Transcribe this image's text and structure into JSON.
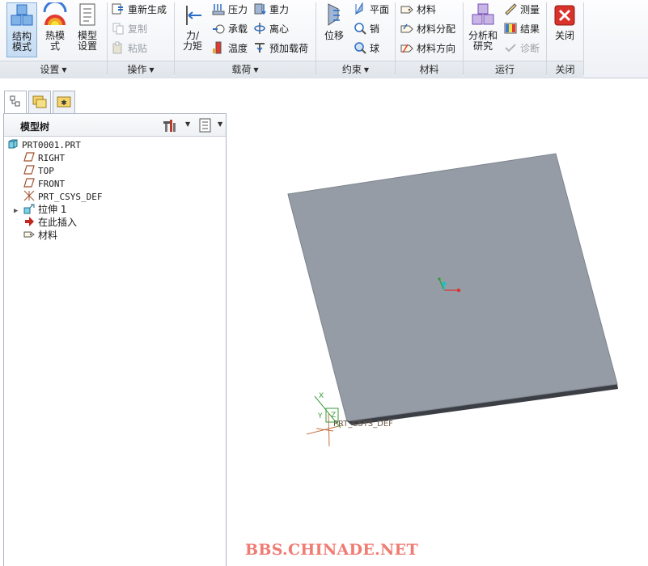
{
  "ribbon": {
    "groups": {
      "settings": "设置",
      "operations": "操作",
      "loads": "载荷",
      "constraints": "约束",
      "materials": "材料",
      "run": "运行",
      "close": "关闭"
    },
    "structure_mode": [
      "结构",
      "模式"
    ],
    "thermal_mode": [
      "热模",
      "式"
    ],
    "model_setup": [
      "模型",
      "设置"
    ],
    "regenerate": "重新生成",
    "copy": "复制",
    "paste": "粘贴",
    "force_moment": [
      "力/",
      "力矩"
    ],
    "pressure": "压力",
    "bearing": "承载",
    "temperature": "温度",
    "gravity": "重力",
    "centrifugal": "离心",
    "preload": "预加载荷",
    "displacement": "位移",
    "planar": "平面",
    "pin": "销",
    "ball": "球",
    "material": "材料",
    "material_assign": "材料分配",
    "material_orient": "材料方向",
    "analysis": [
      "分析和",
      "研究"
    ],
    "measure": "测量",
    "results": "结果",
    "diagnose": "诊断",
    "close_btn": "关闭"
  },
  "tree": {
    "title": "模型树",
    "nodes": [
      {
        "label": "PRT0001.PRT"
      },
      {
        "label": "RIGHT"
      },
      {
        "label": "TOP"
      },
      {
        "label": "FRONT"
      },
      {
        "label": "PRT_CSYS_DEF"
      },
      {
        "label": "拉伸 1"
      },
      {
        "label": "在此插入"
      },
      {
        "label": "材料"
      }
    ]
  },
  "viewport": {
    "csys_label": "PRT_CSYS_DEF"
  },
  "watermark": "BBS.CHINADE.NET",
  "colors": {
    "plate_top": "#959ca6",
    "plate_edge": "#3b3e44",
    "accent_blue": "#2b6cc4",
    "watermark": "#f07b72"
  }
}
